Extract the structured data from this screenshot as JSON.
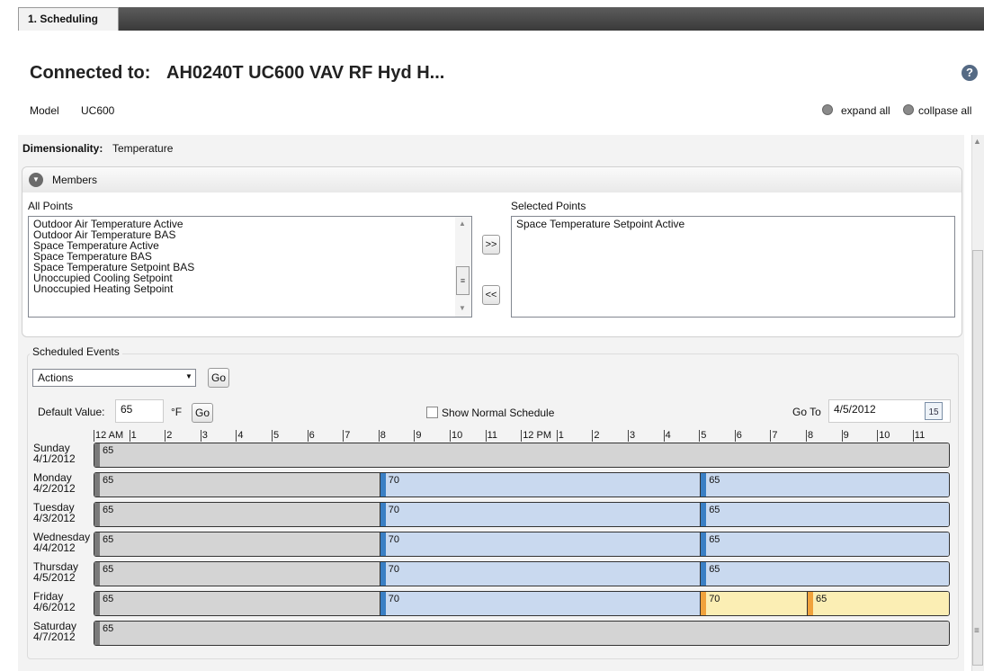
{
  "tab": {
    "label": "1. Scheduling"
  },
  "header": {
    "connected_label": "Connected to:",
    "connected_value": "AH0240T UC600 VAV RF Hyd H...",
    "help": "?"
  },
  "model": {
    "label": "Model",
    "value": "UC600"
  },
  "controls": {
    "expand_all": "expand all",
    "collapse_all": "collpase all"
  },
  "dimensionality": {
    "label": "Dimensionality:",
    "value": "Temperature"
  },
  "members": {
    "title": "Members",
    "all_points_label": "All Points",
    "selected_points_label": "Selected Points",
    "all_points": [
      "Outdoor Air Temperature Active",
      "Outdoor Air Temperature BAS",
      "Space Temperature Active",
      "Space Temperature BAS",
      "Space Temperature Setpoint BAS",
      "Unoccupied Cooling Setpoint",
      "Unoccupied Heating Setpoint"
    ],
    "selected_points": [
      "Space Temperature Setpoint Active"
    ],
    "add_label": ">>",
    "remove_label": "<<"
  },
  "events": {
    "title": "Scheduled Events",
    "actions_value": "Actions",
    "go_label": "Go",
    "default_label": "Default Value:",
    "default_value": "65",
    "unit": "°F",
    "show_normal_label": "Show Normal Schedule",
    "goto_label": "Go To",
    "goto_value": "4/5/2012",
    "calendar_day": "15",
    "hours": [
      "12 AM",
      "1",
      "2",
      "3",
      "4",
      "5",
      "6",
      "7",
      "8",
      "9",
      "10",
      "11",
      "12 PM",
      "1",
      "2",
      "3",
      "4",
      "5",
      "6",
      "7",
      "8",
      "9",
      "10",
      "11"
    ],
    "days": [
      {
        "name": "Sunday",
        "date": "4/1/2012",
        "segments": [
          {
            "start": 0,
            "value": "65",
            "type": "gray"
          }
        ]
      },
      {
        "name": "Monday",
        "date": "4/2/2012",
        "segments": [
          {
            "start": 0,
            "value": "65",
            "type": "gray"
          },
          {
            "start": 8,
            "value": "70",
            "type": "blue"
          },
          {
            "start": 17,
            "value": "65",
            "type": "blue"
          }
        ]
      },
      {
        "name": "Tuesday",
        "date": "4/3/2012",
        "segments": [
          {
            "start": 0,
            "value": "65",
            "type": "gray"
          },
          {
            "start": 8,
            "value": "70",
            "type": "blue"
          },
          {
            "start": 17,
            "value": "65",
            "type": "blue"
          }
        ]
      },
      {
        "name": "Wednesday",
        "date": "4/4/2012",
        "segments": [
          {
            "start": 0,
            "value": "65",
            "type": "gray"
          },
          {
            "start": 8,
            "value": "70",
            "type": "blue"
          },
          {
            "start": 17,
            "value": "65",
            "type": "blue"
          }
        ]
      },
      {
        "name": "Thursday",
        "date": "4/5/2012",
        "segments": [
          {
            "start": 0,
            "value": "65",
            "type": "gray"
          },
          {
            "start": 8,
            "value": "70",
            "type": "blue"
          },
          {
            "start": 17,
            "value": "65",
            "type": "blue"
          }
        ]
      },
      {
        "name": "Friday",
        "date": "4/6/2012",
        "segments": [
          {
            "start": 0,
            "value": "65",
            "type": "gray"
          },
          {
            "start": 8,
            "value": "70",
            "type": "blue"
          },
          {
            "start": 17,
            "value": "70",
            "type": "yellow"
          },
          {
            "start": 20,
            "value": "65",
            "type": "yellow"
          }
        ]
      },
      {
        "name": "Saturday",
        "date": "4/7/2012",
        "segments": [
          {
            "start": 0,
            "value": "65",
            "type": "gray"
          }
        ]
      }
    ]
  },
  "colors": {
    "gray_fill": "#d4d4d4",
    "gray_mark": "#7a7a7a",
    "blue_fill": "#c9d9ef",
    "blue_mark": "#3a7fc4",
    "yellow_fill": "#fbeeb4",
    "yellow_mark": "#f0a23c"
  }
}
